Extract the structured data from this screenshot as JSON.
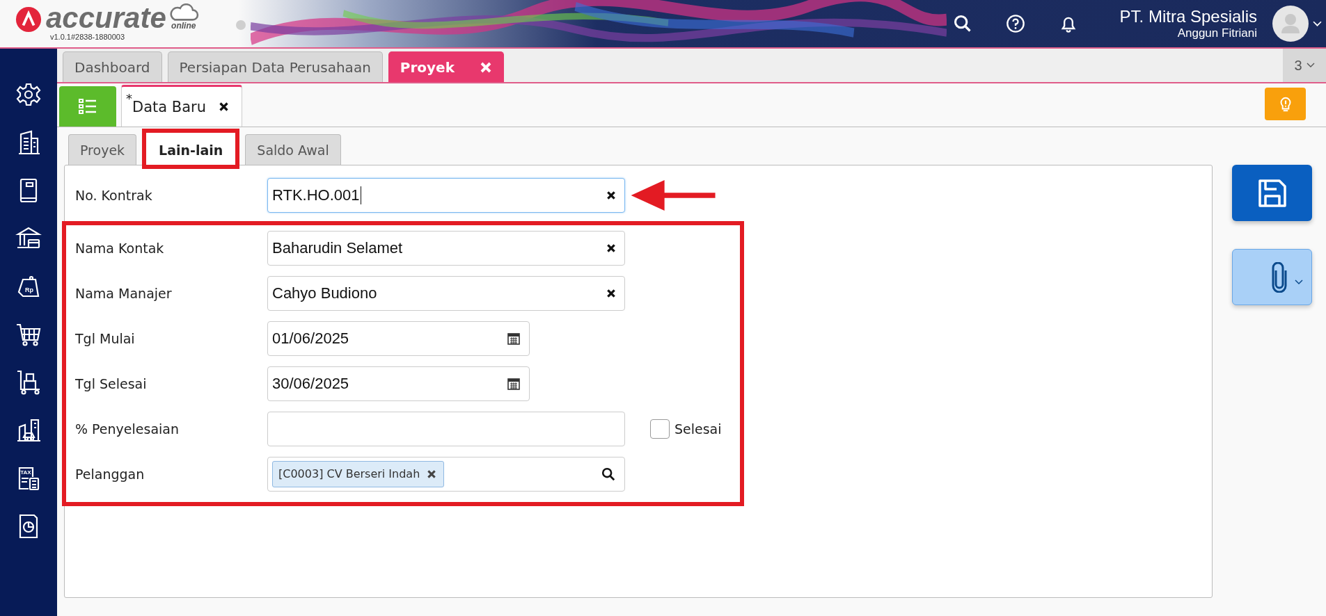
{
  "header": {
    "logo_text": "accurate",
    "logo_sub": "online",
    "version": "v1.0.1#2838-1880003",
    "company": "PT. Mitra Spesialis",
    "user": "Anggun Fitriani"
  },
  "sidebar": [
    {
      "kind": "gear"
    },
    {
      "kind": "building"
    },
    {
      "kind": "book"
    },
    {
      "kind": "bank"
    },
    {
      "kind": "tag",
      "icon_text": "Rp"
    },
    {
      "kind": "cart"
    },
    {
      "kind": "trolley"
    },
    {
      "kind": "factory"
    },
    {
      "kind": "tax",
      "icon_text": "TAX"
    },
    {
      "kind": "report"
    }
  ],
  "tabs": [
    {
      "label": "Dashboard",
      "selected": false,
      "closable": false
    },
    {
      "label": "Persiapan Data Perusahaan",
      "selected": false,
      "closable": false
    },
    {
      "label": "Proyek",
      "selected": true,
      "closable": true
    }
  ],
  "tab_count": "3",
  "doc_tab": {
    "modified_mark": "*",
    "label": "Data Baru"
  },
  "subtabs": [
    {
      "label": "Proyek",
      "selected": false,
      "highlighted": false
    },
    {
      "label": "Lain-lain",
      "selected": true,
      "highlighted": true
    },
    {
      "label": "Saldo Awal",
      "selected": false,
      "highlighted": false
    }
  ],
  "form": {
    "fields": [
      {
        "kind": "text",
        "label": "No. Kontrak",
        "value": "RTK.HO.001",
        "focused": true,
        "arrow": true
      }
    ],
    "highlighted_group": [
      {
        "kind": "text",
        "label": "Nama Kontak",
        "value": "Baharudin Selamet",
        "focused": false,
        "arrow": false
      },
      {
        "kind": "text",
        "label": "Nama Manajer",
        "value": "Cahyo Budiono",
        "focused": false,
        "arrow": false
      },
      {
        "kind": "date",
        "label": "Tgl Mulai",
        "value": "01/06/2025",
        "focused": false,
        "arrow": false
      },
      {
        "kind": "date",
        "label": "Tgl Selesai",
        "value": "30/06/2025",
        "focused": false,
        "arrow": false
      },
      {
        "kind": "percent",
        "label": "% Penyelesaian",
        "checkbox_label": "Selesai",
        "checked": false,
        "focused": false,
        "arrow": false
      },
      {
        "kind": "tags",
        "label": "Pelanggan",
        "tags": [
          "[C0003] CV Berseri Indah"
        ],
        "focused": false,
        "arrow": false
      }
    ]
  }
}
